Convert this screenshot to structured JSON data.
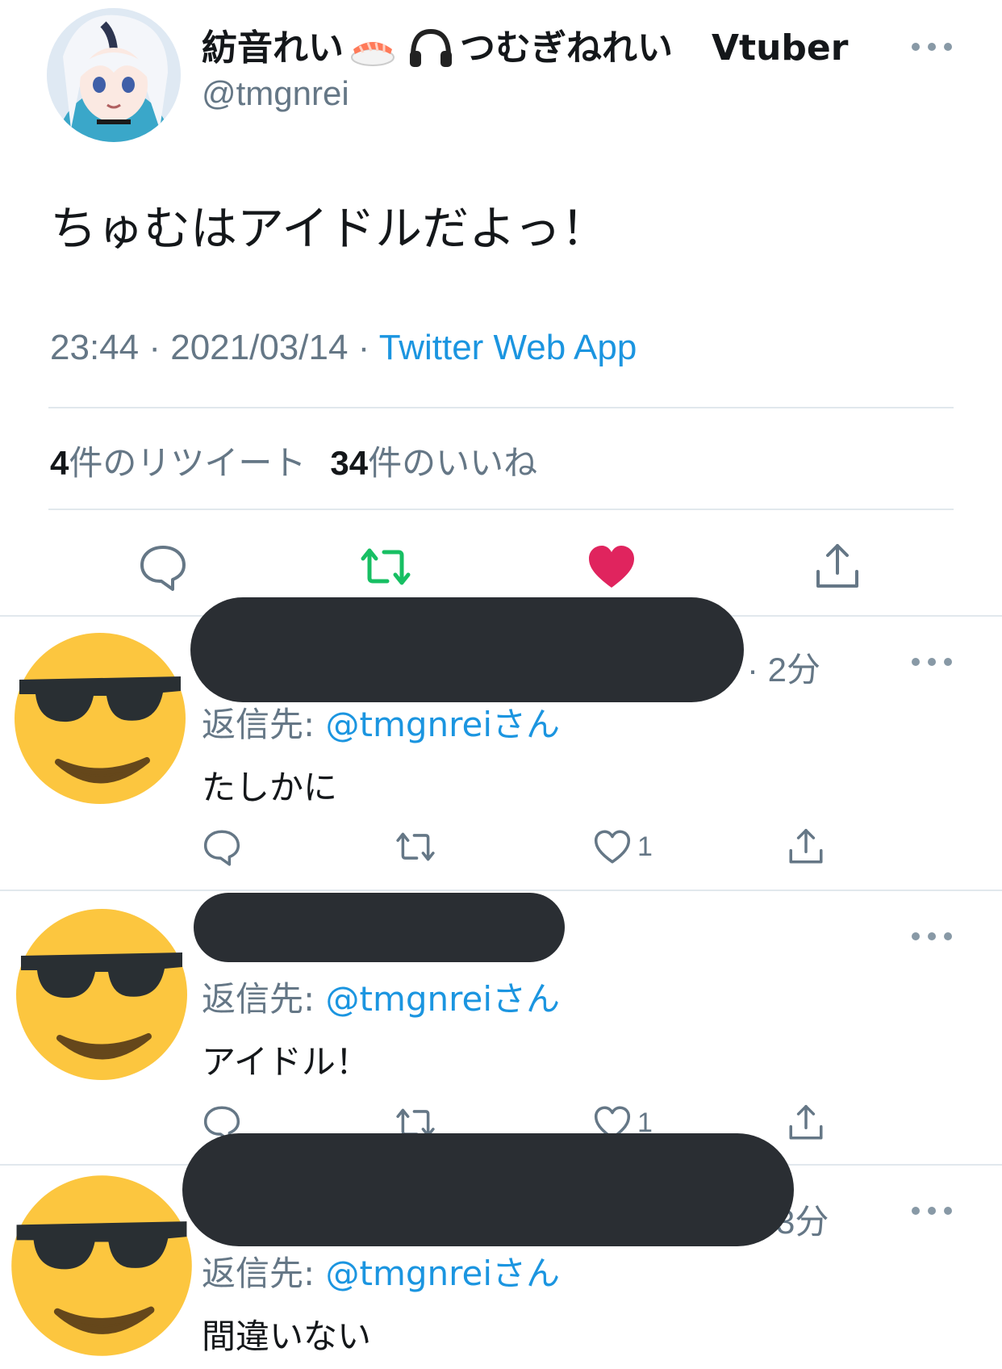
{
  "tweet": {
    "display_name_part1": "紡音れい",
    "display_name_part2": "つむぎねれい",
    "display_name_suffix": "Vtuber",
    "handle": "@tmgnrei",
    "text": "ちゅむはアイドルだよっ！",
    "time": "23:44",
    "date": "2021/03/14",
    "separator": " · ",
    "source": "Twitter Web App",
    "retweet_count": "4",
    "retweet_label": "件のリツイート",
    "like_count": "34",
    "like_label": "件のいいね",
    "icons": [
      "reply-icon",
      "retweet-icon",
      "like-icon",
      "share-icon"
    ],
    "colors": {
      "retweet": "#17bf63",
      "like": "#e0245e",
      "link": "#1b95e0"
    },
    "liked": true,
    "retweeted": true
  },
  "replies": [
    {
      "time": "· 2分",
      "reply_to_label": "返信先: ",
      "reply_to_handle": "@tmgnreiさん",
      "text": "たしかに",
      "like_count": "1"
    },
    {
      "time": "",
      "reply_to_label": "返信先: ",
      "reply_to_handle": "@tmgnreiさん",
      "text": "アイドル！",
      "like_count": "1"
    },
    {
      "time": "3分",
      "reply_to_label": "返信先: ",
      "reply_to_handle": "@tmgnreiさん",
      "text": "間違いない",
      "like_count": ""
    }
  ]
}
